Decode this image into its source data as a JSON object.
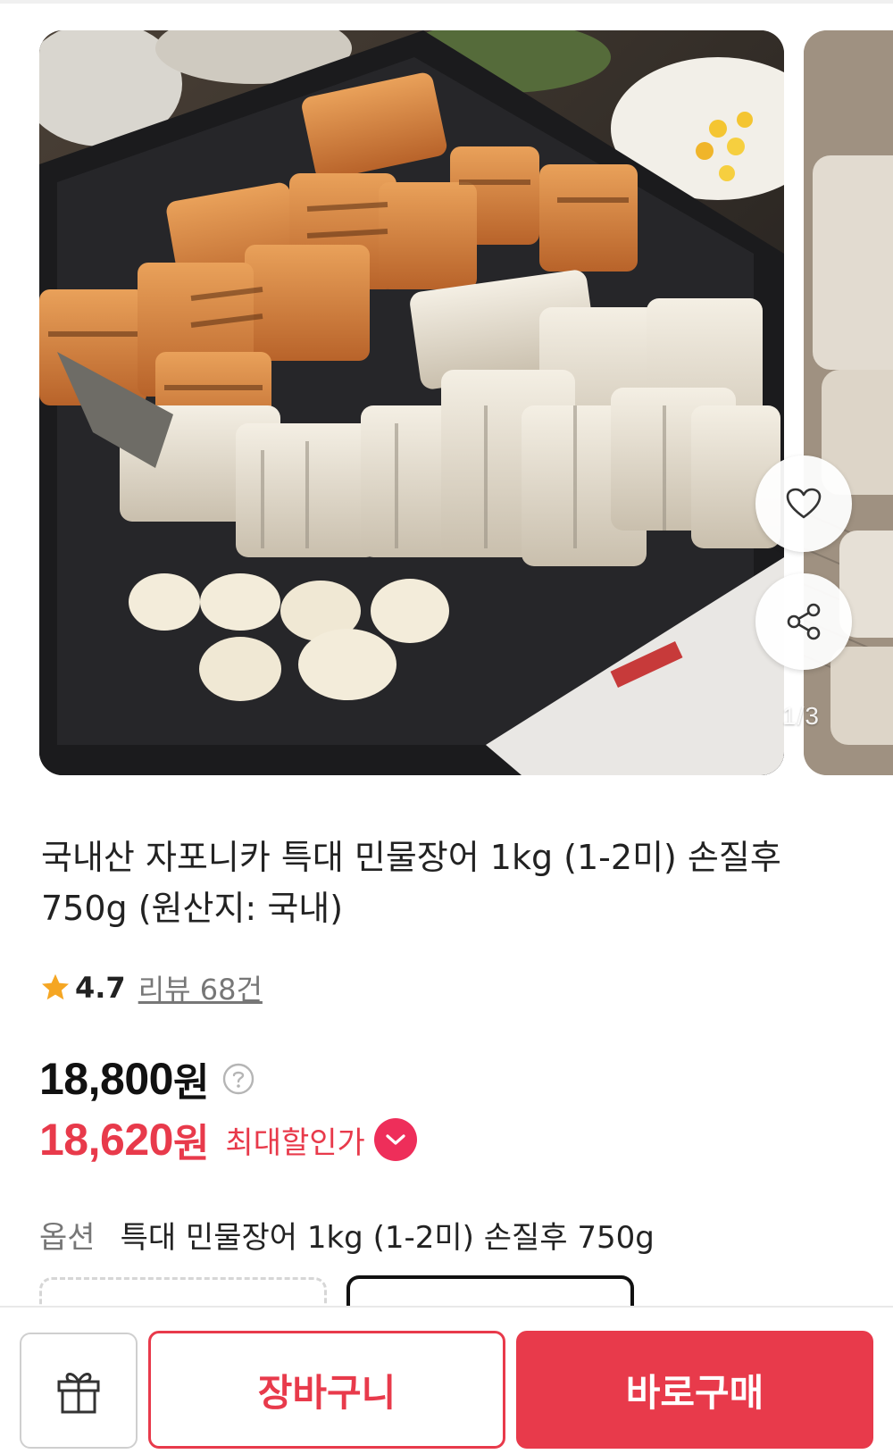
{
  "gallery": {
    "counter": "1/3",
    "main_image": "grilled-eel-on-griddle-photo",
    "next_image": "eel-on-grill-photo"
  },
  "product": {
    "title": "국내산 자포니카 특대 민물장어 1kg (1-2미) 손질후 750g (원산지: 국내)",
    "rating": "4.7",
    "review_text": "리뷰 68건"
  },
  "price": {
    "original": "18,800",
    "original_unit": "원",
    "sale": "18,620",
    "sale_unit": "원",
    "max_discount_label": "최대할인가"
  },
  "option": {
    "label": "옵션",
    "value": "특대 민물장어 1kg (1-2미) 손질후 750g"
  },
  "bottom_bar": {
    "gift_icon": "gift-icon",
    "cart_label": "장바구니",
    "buy_label": "바로구매"
  },
  "colors": {
    "accent": "#e83a4b",
    "star": "#f5a623",
    "badge": "#ee2e5a"
  }
}
